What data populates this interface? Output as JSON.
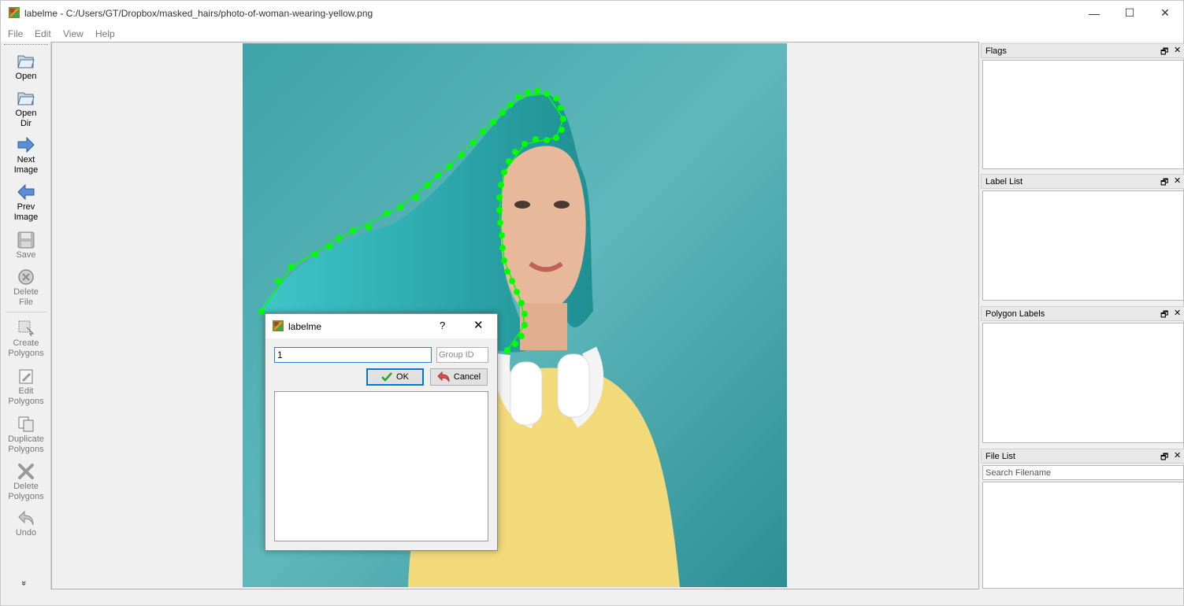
{
  "window": {
    "title": "labelme - C:/Users/GT/Dropbox/masked_hairs/photo-of-woman-wearing-yellow.png",
    "minimize_glyph": "—",
    "maximize_glyph": "☐",
    "close_glyph": "✕"
  },
  "menu": {
    "file": "File",
    "edit": "Edit",
    "view": "View",
    "help": "Help"
  },
  "toolbar": {
    "open": "Open",
    "open_dir": "Open\nDir",
    "next_image": "Next\nImage",
    "prev_image": "Prev\nImage",
    "save": "Save",
    "delete_file": "Delete\nFile",
    "create_polygons": "Create\nPolygons",
    "edit_polygons": "Edit\nPolygons",
    "duplicate_polygons": "Duplicate\nPolygons",
    "delete_polygons": "Delete\nPolygons",
    "undo": "Undo",
    "more_glyph": "»"
  },
  "docks": {
    "flags": "Flags",
    "label_list": "Label List",
    "polygon_labels": "Polygon Labels",
    "file_list": "File List",
    "search_placeholder": "Search Filename",
    "float_glyph": "🗗",
    "close_glyph": "✕"
  },
  "dialog": {
    "title": "labelme",
    "help_glyph": "?",
    "close_glyph": "✕",
    "label_value": "1",
    "group_id_placeholder": "Group ID",
    "ok_label": "OK",
    "cancel_label": "Cancel"
  },
  "colors": {
    "polygon_point": "#00ff00",
    "hair_mask": "#2aa6a8",
    "background_teal": "#3a9ea3",
    "shirt_yellow": "#f2d97a"
  }
}
